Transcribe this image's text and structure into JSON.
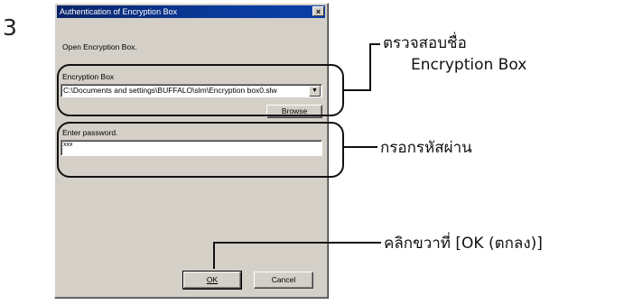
{
  "step_number": "3",
  "dialog": {
    "title": "Authentication of Encryption Box",
    "close_glyph": "×",
    "instruction": "Open Encryption Box.",
    "encryption_box_label": "Encryption Box",
    "encryption_box_path": "C:\\Documents and settings\\BUFFALO\\slm\\Encryption box0.slw",
    "combo_arrow_glyph": "▼",
    "browse_label": "Browse",
    "password_label": "Enter password.",
    "password_value": "xxx",
    "ok_label": "OK",
    "cancel_label": "Cancel"
  },
  "callouts": {
    "check_name_line1": "ตรวจสอบชื่อ",
    "check_name_line2": "Encryption Box",
    "enter_password": "กรอกรหัสผ่าน",
    "click_ok": "คลิกขวาที่ [OK (ตกลง)]"
  }
}
